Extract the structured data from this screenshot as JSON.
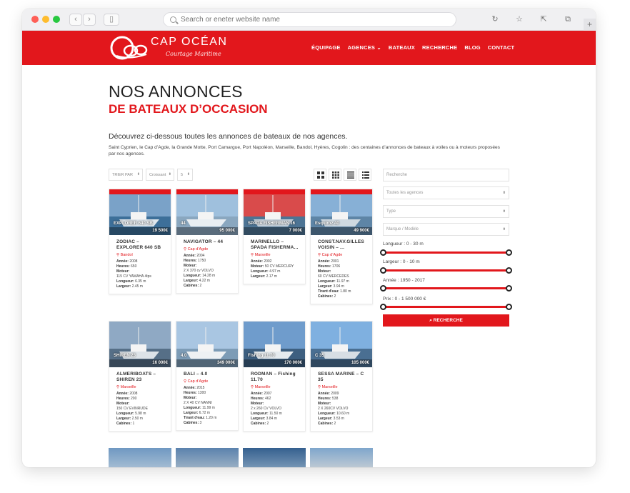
{
  "browser": {
    "address_placeholder": "Search or eneter website name",
    "back_icon": "chevron-left-icon",
    "forward_icon": "chevron-right-icon",
    "plus_label": "+"
  },
  "header": {
    "logo_title": "CAP OCÉAN",
    "logo_subtitle": "Courtage Maritime",
    "menu": [
      "ÉQUIPAGE",
      "AGENCES ⌄",
      "BATEAUX",
      "RECHERCHE",
      "BLOG",
      "CONTACT"
    ],
    "brand_color": "#e2171c"
  },
  "page": {
    "title": "NOS ANNONCES",
    "subtitle": "DE BATEAUX D’OCCASION",
    "intro": "Découvrez ci-dessous toutes les annonces de bateaux de nos agences.",
    "description": "Saint Cyprien, le Cap d’Agde, la Grande Motte, Port Camargue, Port Napoléon, Marseille, Bandol, Hyères, Cogolin : des centaines d’annonces de bateaux à voiles ou à moteurs proposées par nos agences."
  },
  "controls": {
    "sort_by": "TRIER PAR",
    "order": "Croissant",
    "per_page": "5"
  },
  "listings": [
    {
      "overlay": "EXPLORER 640 SB",
      "price": "19 500€",
      "title": "ZODIAC – EXPLORER 640 SB",
      "location": "Bandol",
      "lines": [
        [
          "Année:",
          "2008"
        ],
        [
          "Heures:",
          "650"
        ],
        [
          "Moteur:",
          ""
        ],
        [
          "",
          "115 CV YAMAHA 4tps"
        ],
        [
          "Longueur:",
          "6.35 m"
        ],
        [
          "Largeur:",
          "2.45 m"
        ]
      ]
    },
    {
      "overlay": "44",
      "price": "95 000€",
      "title": "NAVIGATOR – 44",
      "location": "Cap d’Agde",
      "lines": [
        [
          "Année:",
          "2004"
        ],
        [
          "Heures:",
          "1750"
        ],
        [
          "Moteur:",
          ""
        ],
        [
          "",
          "2 X 370 cv VOLVO"
        ],
        [
          "Longueur:",
          "14.28 m"
        ],
        [
          "Largeur:",
          "4.22 m"
        ],
        [
          "Cabines:",
          "2"
        ]
      ]
    },
    {
      "overlay": "SPADA FISHERMAN 16",
      "price": "7 000€",
      "title": "MARINELLO – SPADA FISHERMA...",
      "location": "Marseille",
      "lines": [
        [
          "Année:",
          "2002"
        ],
        [
          "Moteur:",
          "50 CV MERCURY"
        ],
        [
          "Longueur:",
          "4.97 m"
        ],
        [
          "Largeur:",
          "2.17 m"
        ]
      ]
    },
    {
      "overlay": "Esquiroz 40",
      "price": "49 900€",
      "title": "CONST.NAV.GILLES VOISIN – ...",
      "location": "Cap d’Agde",
      "lines": [
        [
          "Année:",
          "2001"
        ],
        [
          "Heures:",
          "1706"
        ],
        [
          "Moteur:",
          ""
        ],
        [
          "",
          "60 CV MERCEDES"
        ],
        [
          "Longueur:",
          "11.97 m"
        ],
        [
          "Largeur:",
          "3.94 m"
        ],
        [
          "Tirant d'eau:",
          "1.80 m"
        ],
        [
          "Cabines:",
          "2"
        ]
      ]
    },
    {
      "overlay": "SHIREN 23",
      "price": "16 000€",
      "title": "ALMERIBOATS – SHIREN 23",
      "location": "Marseille",
      "lines": [
        [
          "Année:",
          "2008"
        ],
        [
          "Heures:",
          "200"
        ],
        [
          "Moteur:",
          ""
        ],
        [
          "",
          "150 CV EVINRUDE"
        ],
        [
          "Longueur:",
          "5.98 m"
        ],
        [
          "Largeur:",
          "2.50 m"
        ],
        [
          "Cabines:",
          "1"
        ]
      ]
    },
    {
      "overlay": "4.0",
      "price": "349 000€",
      "title": "BALI – 4.0",
      "location": "Cap d’Agde",
      "lines": [
        [
          "Année:",
          "2015"
        ],
        [
          "Heures:",
          "1300"
        ],
        [
          "Moteur:",
          ""
        ],
        [
          "",
          "2 X 40 CV NANNI"
        ],
        [
          "Longueur:",
          "11.99 m"
        ],
        [
          "Largeur:",
          "6.72 m"
        ],
        [
          "Tirant d'eau:",
          "1.20 m"
        ],
        [
          "Cabines:",
          "3"
        ]
      ]
    },
    {
      "overlay": "Fishing 11.70",
      "price": "170 000€",
      "title": "RODMAN – Fishing 11.70",
      "location": "Marseille",
      "lines": [
        [
          "Année:",
          "2007"
        ],
        [
          "Heures:",
          "462"
        ],
        [
          "Moteur:",
          ""
        ],
        [
          "",
          "2 x 260 CV VOLVO"
        ],
        [
          "Longueur:",
          "11.50 m"
        ],
        [
          "Largeur:",
          "3.84 m"
        ],
        [
          "Cabines:",
          "2"
        ]
      ]
    },
    {
      "overlay": "C 35",
      "price": "105 000€",
      "title": "SESSA MARINE – C 35",
      "location": "Marseille",
      "lines": [
        [
          "Année:",
          "2009"
        ],
        [
          "Heures:",
          "538"
        ],
        [
          "Moteur:",
          ""
        ],
        [
          "",
          "2 X 260CV VOLVO"
        ],
        [
          "Longueur:",
          "10.60 m"
        ],
        [
          "Largeur:",
          "3.53 m"
        ],
        [
          "Cabines:",
          "2"
        ]
      ]
    }
  ],
  "sidebar": {
    "search_placeholder": "Recherche",
    "agencies": "Toutes les agences",
    "type": "Type",
    "brand_model": "Marque / Modèle",
    "length_label": "Longueur : 0 - 30 m",
    "width_label": "Largeur : 0 - 10 m",
    "year_label": "Année : 1950 - 2017",
    "price_label": "Prix : 0 - 1 500 000 €",
    "search_button": "RECHERCHE"
  }
}
